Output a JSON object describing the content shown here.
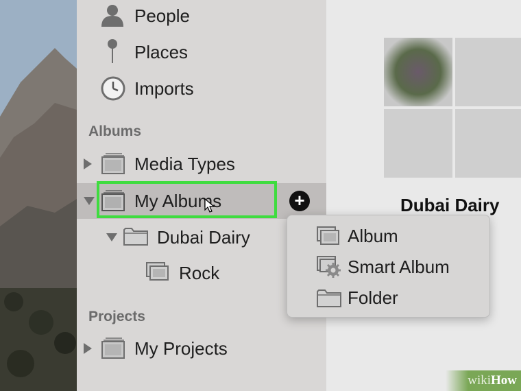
{
  "sidebar": {
    "top_items": [
      {
        "label": "People",
        "icon": "person-icon"
      },
      {
        "label": "Places",
        "icon": "pin-icon"
      },
      {
        "label": "Imports",
        "icon": "clock-icon"
      }
    ],
    "albums_header": "Albums",
    "albums": {
      "media_types": "Media Types",
      "my_albums": "My Albums",
      "dubai_dairy": "Dubai Dairy",
      "rock": "Rock"
    },
    "projects_header": "Projects",
    "projects": {
      "my_projects": "My Projects"
    }
  },
  "add_button": {
    "glyph": "+"
  },
  "context_menu": {
    "items": [
      {
        "label": "Album",
        "icon": "album-icon"
      },
      {
        "label": "Smart Album",
        "icon": "smart-album-icon"
      },
      {
        "label": "Folder",
        "icon": "folder-icon"
      }
    ]
  },
  "main": {
    "album_title": "Dubai Dairy"
  },
  "watermark": {
    "wiki": "wiki",
    "how": "How"
  },
  "colors": {
    "highlight_box": "#3fdc3f",
    "sidebar_bg": "#d9d7d6",
    "selected_row_bg": "#bfbcbb"
  }
}
